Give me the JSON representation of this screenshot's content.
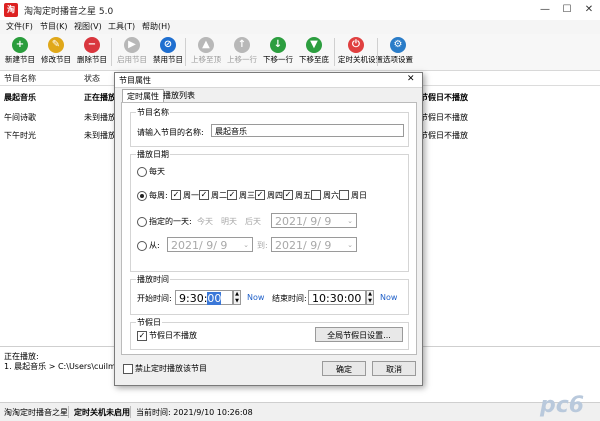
{
  "window": {
    "title": "淘淘定时播音之星 5.0",
    "minimize": "—",
    "maximize": "☐",
    "close": "✕"
  },
  "menu": [
    "文件(F)",
    "节目(K)",
    "视图(V)",
    "工具(T)",
    "帮助(H)"
  ],
  "toolbar": [
    {
      "label": "新建节目",
      "icon": "new-program-icon",
      "color": "#2a9d3c",
      "glyph": "+",
      "enabled": true
    },
    {
      "label": "修改节目",
      "icon": "edit-program-icon",
      "color": "#e0a81a",
      "glyph": "✎",
      "enabled": true
    },
    {
      "label": "删除节目",
      "icon": "delete-program-icon",
      "color": "#d9363e",
      "glyph": "−",
      "enabled": true
    },
    {
      "label": "启用节目",
      "icon": "enable-program-icon",
      "color": "#b8b8b8",
      "glyph": "▶",
      "enabled": false
    },
    {
      "label": "禁用节目",
      "icon": "disable-program-icon",
      "color": "#1f6fd0",
      "glyph": "⊘",
      "enabled": true
    },
    {
      "label": "上移至顶",
      "icon": "move-top-icon",
      "color": "#b8b8b8",
      "glyph": "▲",
      "enabled": false
    },
    {
      "label": "上移一行",
      "icon": "move-up-icon",
      "color": "#b8b8b8",
      "glyph": "↑",
      "enabled": false
    },
    {
      "label": "下移一行",
      "icon": "move-down-icon",
      "color": "#2c9e3f",
      "glyph": "↓",
      "enabled": true
    },
    {
      "label": "下移至底",
      "icon": "move-bottom-icon",
      "color": "#2c9e3f",
      "glyph": "▼",
      "enabled": true
    },
    {
      "label": "定时关机设置",
      "icon": "power-icon",
      "color": "#e04040",
      "glyph": "⏻",
      "enabled": true
    },
    {
      "label": "选项设置",
      "icon": "settings-icon",
      "color": "#2a7cc8",
      "glyph": "⚙",
      "enabled": true
    }
  ],
  "list": {
    "headers": [
      "节目名称",
      "状态"
    ],
    "rows": [
      {
        "name": "晨起音乐",
        "status": "正在播放",
        "tail": "节假日不播放",
        "bold": true
      },
      {
        "name": "午间诗歌",
        "status": "未到播放时",
        "tail": "节假日不播放",
        "bold": false
      },
      {
        "name": "下午时光",
        "status": "未到播放时",
        "tail": "节假日不播放",
        "bold": false
      }
    ]
  },
  "log": {
    "line1": "正在播放:",
    "line2": "1. 晨起音乐 > C:\\Users\\cuilm\\Des"
  },
  "status_bar": {
    "app": "淘淘定时播音之星",
    "shutdown": "定时关机未启用",
    "time": "当前时间: 2021/9/10 10:26:08"
  },
  "watermark": "pc6",
  "dialog": {
    "title": "节目属性",
    "close": "✕",
    "tabs": [
      "定时属性",
      "播放列表"
    ],
    "name_group": {
      "title": "节目名称",
      "prompt": "请输入节目的名称:",
      "value": "晨起音乐"
    },
    "date_group": {
      "title": "播放日期",
      "daily": "每天",
      "weekly": "每周:",
      "weekdays": [
        {
          "label": "周一",
          "checked": true
        },
        {
          "label": "周二",
          "checked": true
        },
        {
          "label": "周三",
          "checked": true
        },
        {
          "label": "周四",
          "checked": true
        },
        {
          "label": "周五",
          "checked": true
        },
        {
          "label": "周六",
          "checked": false
        },
        {
          "label": "周日",
          "checked": false
        }
      ],
      "specific": "指定的一天:",
      "quick": [
        "今天",
        "明天",
        "后天"
      ],
      "specific_date": "2021/ 9/ 9",
      "from": "从:",
      "from_date": "2021/ 9/ 9",
      "to": "到:",
      "to_date": "2021/ 9/ 9"
    },
    "time_group": {
      "title": "播放时间",
      "start_label": "开始时间:",
      "start_h": "9:30:",
      "start_sel": "00",
      "now1": "Now",
      "end_label": "结束时间:",
      "end": "10:30:00",
      "now2": "Now"
    },
    "holiday_group": {
      "title": "节假日",
      "checkbox": "节假日不播放",
      "button": "全局节假日设置..."
    },
    "disable_check": "禁止定时播放该节目",
    "ok": "确定",
    "cancel": "取消"
  }
}
